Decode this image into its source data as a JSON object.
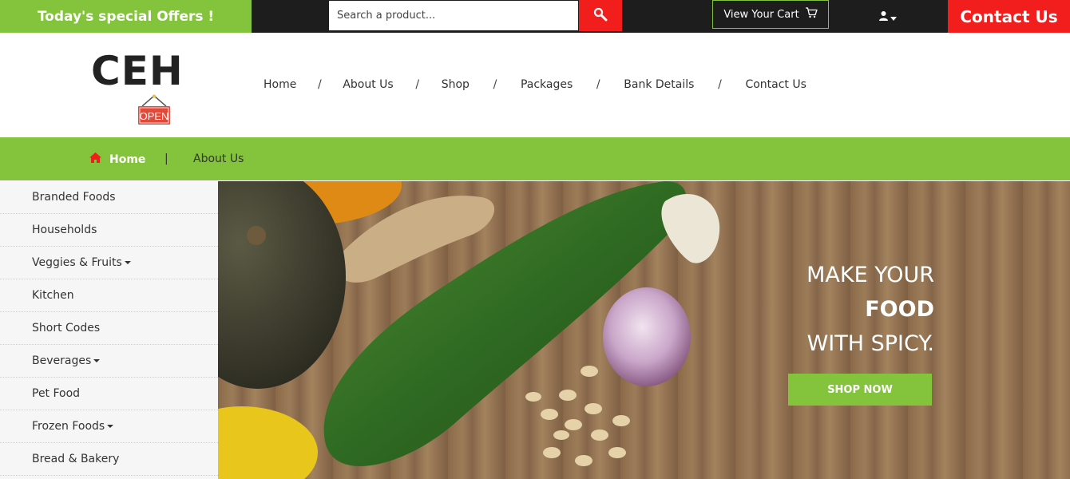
{
  "topbar": {
    "offers_label": "Today's special Offers !",
    "search_placeholder": "Search a product...",
    "cart_label": "View Your Cart",
    "contact_label": "Contact Us"
  },
  "header": {
    "logo_text": "CEH",
    "sign_text": "OPEN",
    "nav": [
      {
        "label": "Home"
      },
      {
        "label": "About Us"
      },
      {
        "label": "Shop"
      },
      {
        "label": "Packages"
      },
      {
        "label": "Bank Details"
      },
      {
        "label": "Contact Us"
      }
    ],
    "separator": "/"
  },
  "breadcrumb": {
    "home": "Home",
    "separator": "|",
    "about": "About Us"
  },
  "sidebar": {
    "items": [
      {
        "label": "Branded Foods",
        "dropdown": false
      },
      {
        "label": "Households",
        "dropdown": false
      },
      {
        "label": "Veggies & Fruits",
        "dropdown": true
      },
      {
        "label": "Kitchen",
        "dropdown": false
      },
      {
        "label": "Short Codes",
        "dropdown": false
      },
      {
        "label": "Beverages",
        "dropdown": true
      },
      {
        "label": "Pet Food",
        "dropdown": false
      },
      {
        "label": "Frozen Foods",
        "dropdown": true
      },
      {
        "label": "Bread & Bakery",
        "dropdown": false
      }
    ]
  },
  "hero": {
    "line1": "MAKE YOUR",
    "line2": "FOOD",
    "line3": "WITH SPICY.",
    "button": "SHOP NOW"
  },
  "icons": {
    "search": "search-icon",
    "cart": "cart-icon",
    "user": "user-icon",
    "home": "home-icon"
  },
  "colors": {
    "green": "#84c33c",
    "red": "#f21d1d",
    "dark": "#1d1d1d"
  }
}
